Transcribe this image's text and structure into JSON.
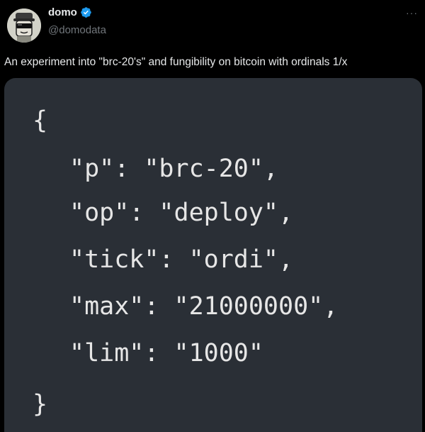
{
  "author": {
    "display_name": "domo",
    "handle": "@domodata",
    "verified": true
  },
  "more_label": "···",
  "tweet_text": "An experiment into \"brc-20's\" and fungibility on bitcoin with ordinals 1/x",
  "code": {
    "open_brace": "{",
    "lines": [
      "\"p\": \"brc-20\",",
      "\"op\": \"deploy\",",
      "\"tick\": \"ordi\",",
      "\"max\": \"21000000\",",
      "\"lim\": \"1000\""
    ],
    "close_brace": "}"
  },
  "colors": {
    "background": "#000000",
    "code_card": "#2a2f36",
    "verified_badge": "#1d9bf0",
    "handle": "#71767b"
  },
  "icons": {
    "verified": "verified-badge-icon",
    "more": "more-options-icon",
    "avatar": "sunglasses-character-avatar"
  }
}
